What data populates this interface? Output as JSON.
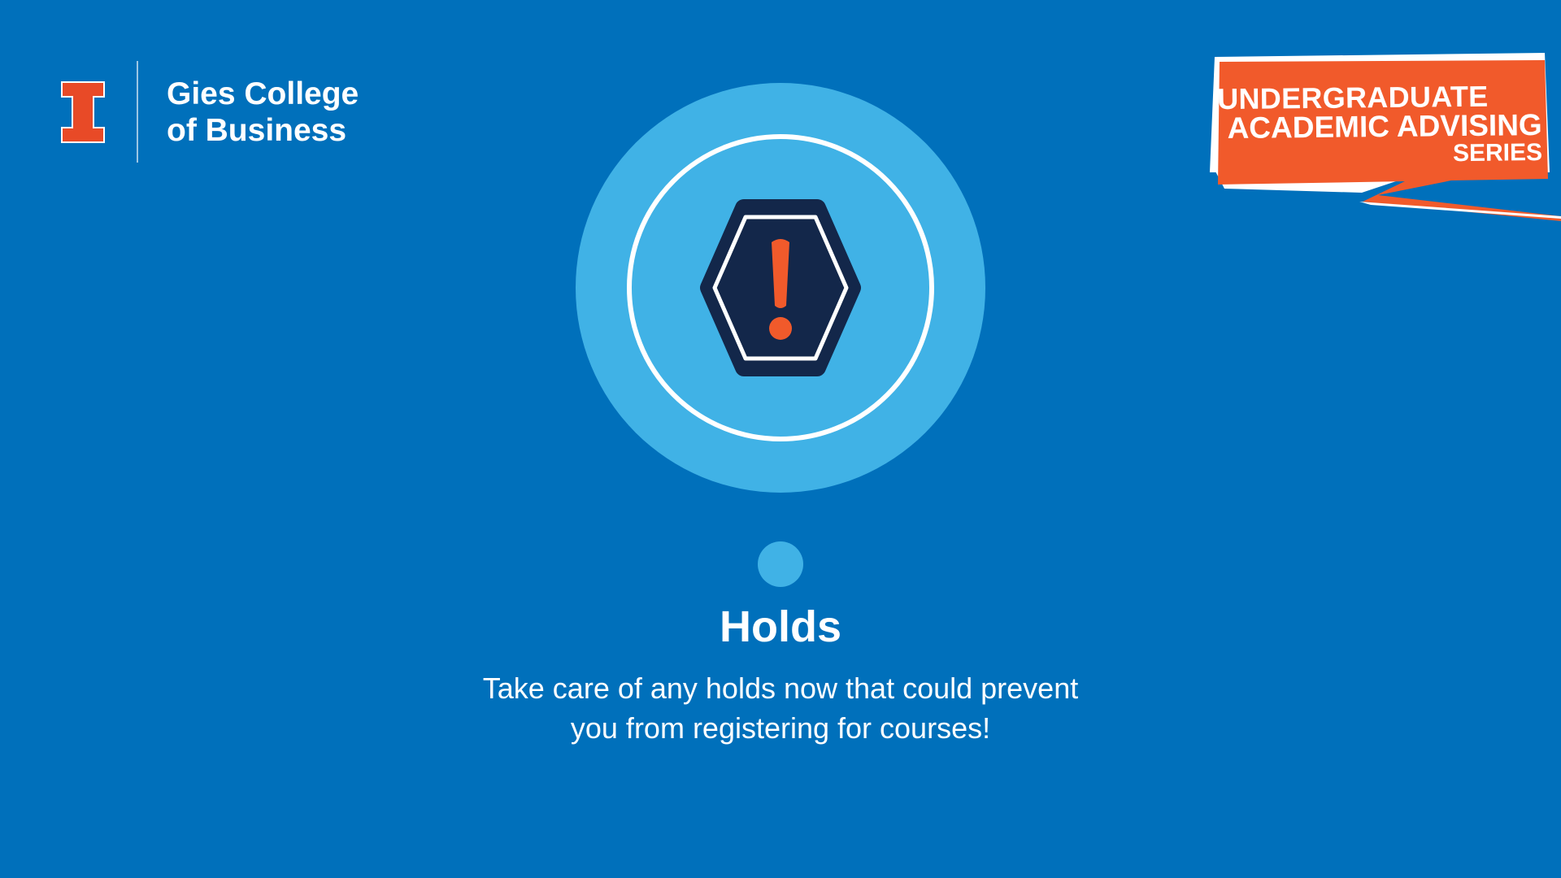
{
  "brand": {
    "line1": "Gies College",
    "line2": "of Business",
    "orange": "#E84A27",
    "blue": "#0070BB"
  },
  "badge": {
    "line1": "UNDERGRADUATE",
    "line2": "ACADEMIC ADVISING",
    "line3": "SERIES",
    "color": "#F15A2B"
  },
  "icon": "alert-hexagon-icon",
  "title": "Holds",
  "description": {
    "line1": "Take care of any holds now that could prevent",
    "line2": "you from registering for courses!"
  }
}
